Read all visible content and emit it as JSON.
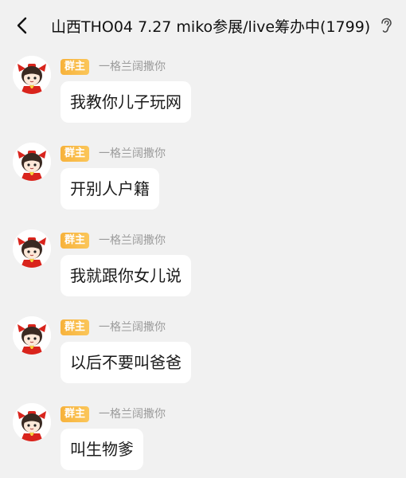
{
  "header": {
    "back_icon": "chevron-left-icon",
    "title": "山西THO04 7.27 miko参展/live筹办中(1799)",
    "ear_icon": "ear-icon"
  },
  "messages": [
    {
      "badge": "群主",
      "nickname": "一格兰阔撒你",
      "text": "我教你儿子玩网"
    },
    {
      "badge": "群主",
      "nickname": "一格兰阔撒你",
      "text": "开别人户籍"
    },
    {
      "badge": "群主",
      "nickname": "一格兰阔撒你",
      "text": "我就跟你女儿说"
    },
    {
      "badge": "群主",
      "nickname": "一格兰阔撒你",
      "text": "以后不要叫爸爸"
    },
    {
      "badge": "群主",
      "nickname": "一格兰阔撒你",
      "text": "叫生物爹"
    }
  ],
  "colors": {
    "background": "#f1f1f1",
    "bubble": "#ffffff",
    "badge": "#f7b23b",
    "nickname": "#9b9b9b"
  }
}
